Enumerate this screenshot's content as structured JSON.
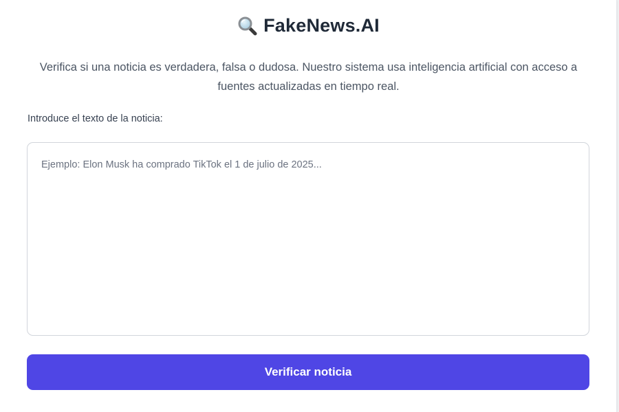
{
  "header": {
    "icon": "magnifying-glass-icon",
    "title": "FakeNews.AI"
  },
  "intro": {
    "description": "Verifica si una noticia es verdadera, falsa o dudosa. Nuestro sistema usa inteligencia artificial con acceso a fuentes actualizadas en tiempo real."
  },
  "form": {
    "label": "Introduce el texto de la noticia:",
    "value": "",
    "placeholder": "Ejemplo: Elon Musk ha comprado TikTok el 1 de julio de 2025...",
    "submit_label": "Verificar noticia"
  },
  "colors": {
    "accent": "#4f46e5",
    "title": "#1f2937",
    "text": "#4b5563",
    "border": "#d1d5db"
  }
}
